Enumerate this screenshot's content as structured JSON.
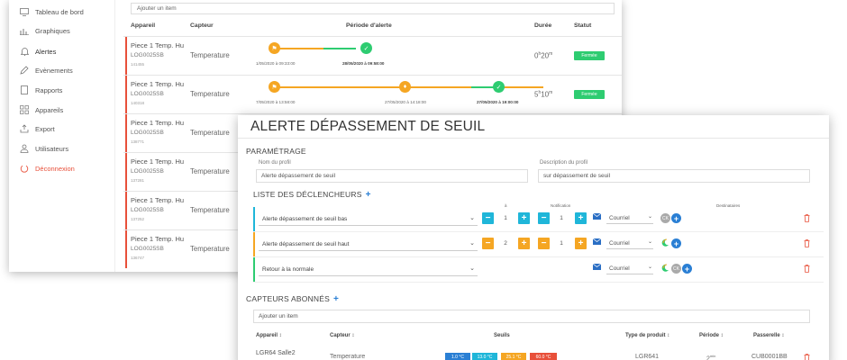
{
  "colors": {
    "blue": "#2a7fd4",
    "cyan": "#1fb6d9",
    "orange": "#f5a623",
    "green": "#2ecc71",
    "red": "#e8503a",
    "grey": "#aaaaaa"
  },
  "sidebar": {
    "items": [
      {
        "label": "Tableau de bord",
        "icon": "monitor-icon"
      },
      {
        "label": "Graphiques",
        "icon": "bar-chart-icon"
      },
      {
        "label": "Alertes",
        "icon": "bell-icon"
      },
      {
        "label": "Evènements",
        "icon": "pencil-icon"
      },
      {
        "label": "Rapports",
        "icon": "document-icon"
      },
      {
        "label": "Appareils",
        "icon": "grid-icon"
      },
      {
        "label": "Export",
        "icon": "export-icon"
      },
      {
        "label": "Utilisateurs",
        "icon": "user-icon"
      },
      {
        "label": "Déconnexion",
        "icon": "power-icon"
      }
    ]
  },
  "alert_list": {
    "search_placeholder": "Ajouter un item",
    "headers": {
      "device": "Appareil",
      "sensor": "Capteur",
      "period": "Période d'alerte",
      "duration": "Durée",
      "status": "Statut"
    },
    "rows": [
      {
        "device": "Piece 1 Temp. Hu",
        "code": "LOG0025SB",
        "id": "141455",
        "sensor": "Temperature",
        "dates": [
          "1/05/2020 à 09:33:00",
          "28/05/2020 à 09:58:00"
        ],
        "duration_main": "0",
        "duration_h": "h",
        "duration_min": "20",
        "duration_m": "m",
        "status": "Fermée"
      },
      {
        "device": "Piece 1 Temp. Hu",
        "code": "LOG0025SB",
        "id": "140318",
        "sensor": "Temperature",
        "dates": [
          "7/05/2020 à 13:58:00",
          "27/05/2020 à 14:18:00",
          "27/05/2020 à 19:00:00"
        ],
        "duration_main": "5",
        "duration_h": "h",
        "duration_min": "10",
        "duration_m": "m",
        "status": "Fermée"
      },
      {
        "device": "Piece 1 Temp. Hu",
        "code": "LOG0025SB",
        "id": "138771",
        "sensor": "Temperature"
      },
      {
        "device": "Piece 1 Temp. Hu",
        "code": "LOG0025SB",
        "id": "137281",
        "sensor": "Temperature"
      },
      {
        "device": "Piece 1 Temp. Hu",
        "code": "LOG0025SB",
        "id": "137252",
        "sensor": "Temperature"
      },
      {
        "device": "Piece 1 Temp. Hu",
        "code": "LOG0025SB",
        "id": "136747",
        "sensor": "Temperature"
      }
    ]
  },
  "dialog": {
    "title": "ALERTE DÉPASSEMENT DE SEUIL",
    "settings_heading": "PARAMÉTRAGE",
    "profile_name_label": "Nom du profil",
    "profile_name_value": "Alerte dépassement de seuil",
    "profile_desc_label": "Description du profil",
    "profile_desc_value": "sur dépassement de seuil",
    "triggers_heading": "LISTE DES DÉCLENCHEURS",
    "trigger_cols": {
      "a": "à",
      "notification": "Notification",
      "recipients": "Destinataires"
    },
    "triggers": [
      {
        "label": "Alerte dépassement de seuil bas",
        "v1": "1",
        "v2": "1",
        "channel": "Courriel",
        "avatar": "CK"
      },
      {
        "label": "Alerte dépassement de seuil haut",
        "v1": "2",
        "v2": "1",
        "channel": "Courriel"
      },
      {
        "label": "Retour à la normale",
        "channel": "Courriel",
        "avatar": "CK"
      }
    ],
    "sensors_heading": "CAPTEURS ABONNÉS",
    "sensors_search_placeholder": "Ajouter un item",
    "sensor_headers": {
      "device": "Appareil",
      "sensor": "Capteur",
      "thresholds": "Seuils",
      "product": "Type de produit",
      "period": "Période",
      "gateway": "Passerelle"
    },
    "sensor_rows": [
      {
        "device": "LGR64 Salle2",
        "sensor": "Temperature",
        "thresholds": [
          "1.0 °C",
          "13.0 °C",
          "25.1 °C",
          "60.0 °C"
        ],
        "product": "LGR641",
        "period": "2",
        "period_unit": "min",
        "gateway": "CUB0001BB"
      }
    ]
  }
}
